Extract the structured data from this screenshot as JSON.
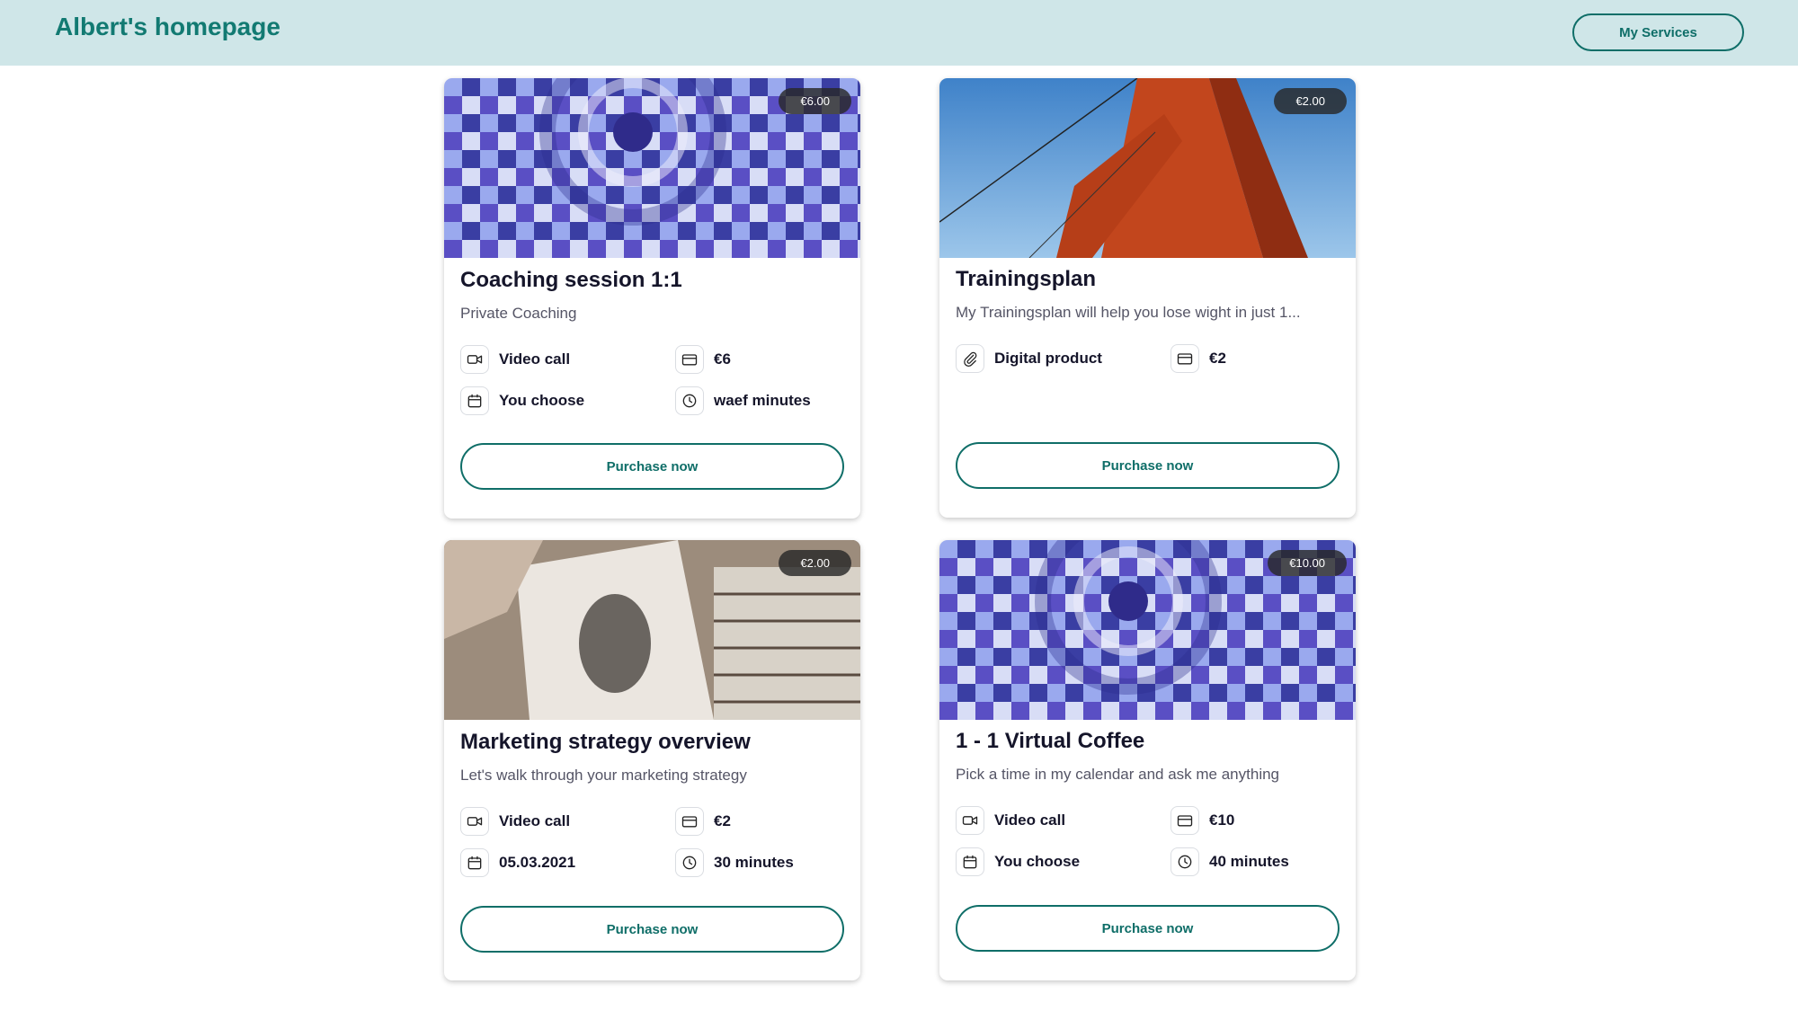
{
  "header": {
    "title": "Albert's homepage",
    "my_services_label": "My Services"
  },
  "cards": [
    {
      "badge": "€6.00",
      "title": "Coaching session 1:1",
      "subtitle": "Private Coaching",
      "info": [
        "Video call",
        "€6",
        "You choose",
        "waef minutes"
      ],
      "button": "Purchase now",
      "image": "hot-air-balloon-image"
    },
    {
      "badge": "€2.00",
      "title": "Trainingsplan",
      "subtitle": "My Trainingsplan will help you lose wight in just 1...",
      "info": [
        "Digital product",
        "€2"
      ],
      "button": "Purchase now",
      "image": "golden-gate-bridge-image"
    },
    {
      "badge": "€2.00",
      "title": "Marketing strategy overview",
      "subtitle": "Let's walk through your marketing strategy",
      "info": [
        "Video call",
        "€2",
        "05.03.2021",
        "30 minutes"
      ],
      "button": "Purchase now",
      "image": "vinyl-records-image"
    },
    {
      "badge": "€10.00",
      "title": "1 - 1 Virtual Coffee",
      "subtitle": "Pick a time in my calendar and ask me anything",
      "info": [
        "Video call",
        "€10",
        "You choose",
        "40 minutes"
      ],
      "button": "Purchase now",
      "image": "hot-air-balloon-image"
    }
  ],
  "icons": {
    "video": "video-camera-icon",
    "card": "credit-card-icon",
    "calendar": "calendar-icon",
    "clock": "clock-icon",
    "clip": "paperclip-icon"
  },
  "colors": {
    "brand": "#127a72",
    "header_bg": "#cfe6e8",
    "button_border": "#0f6e68"
  }
}
